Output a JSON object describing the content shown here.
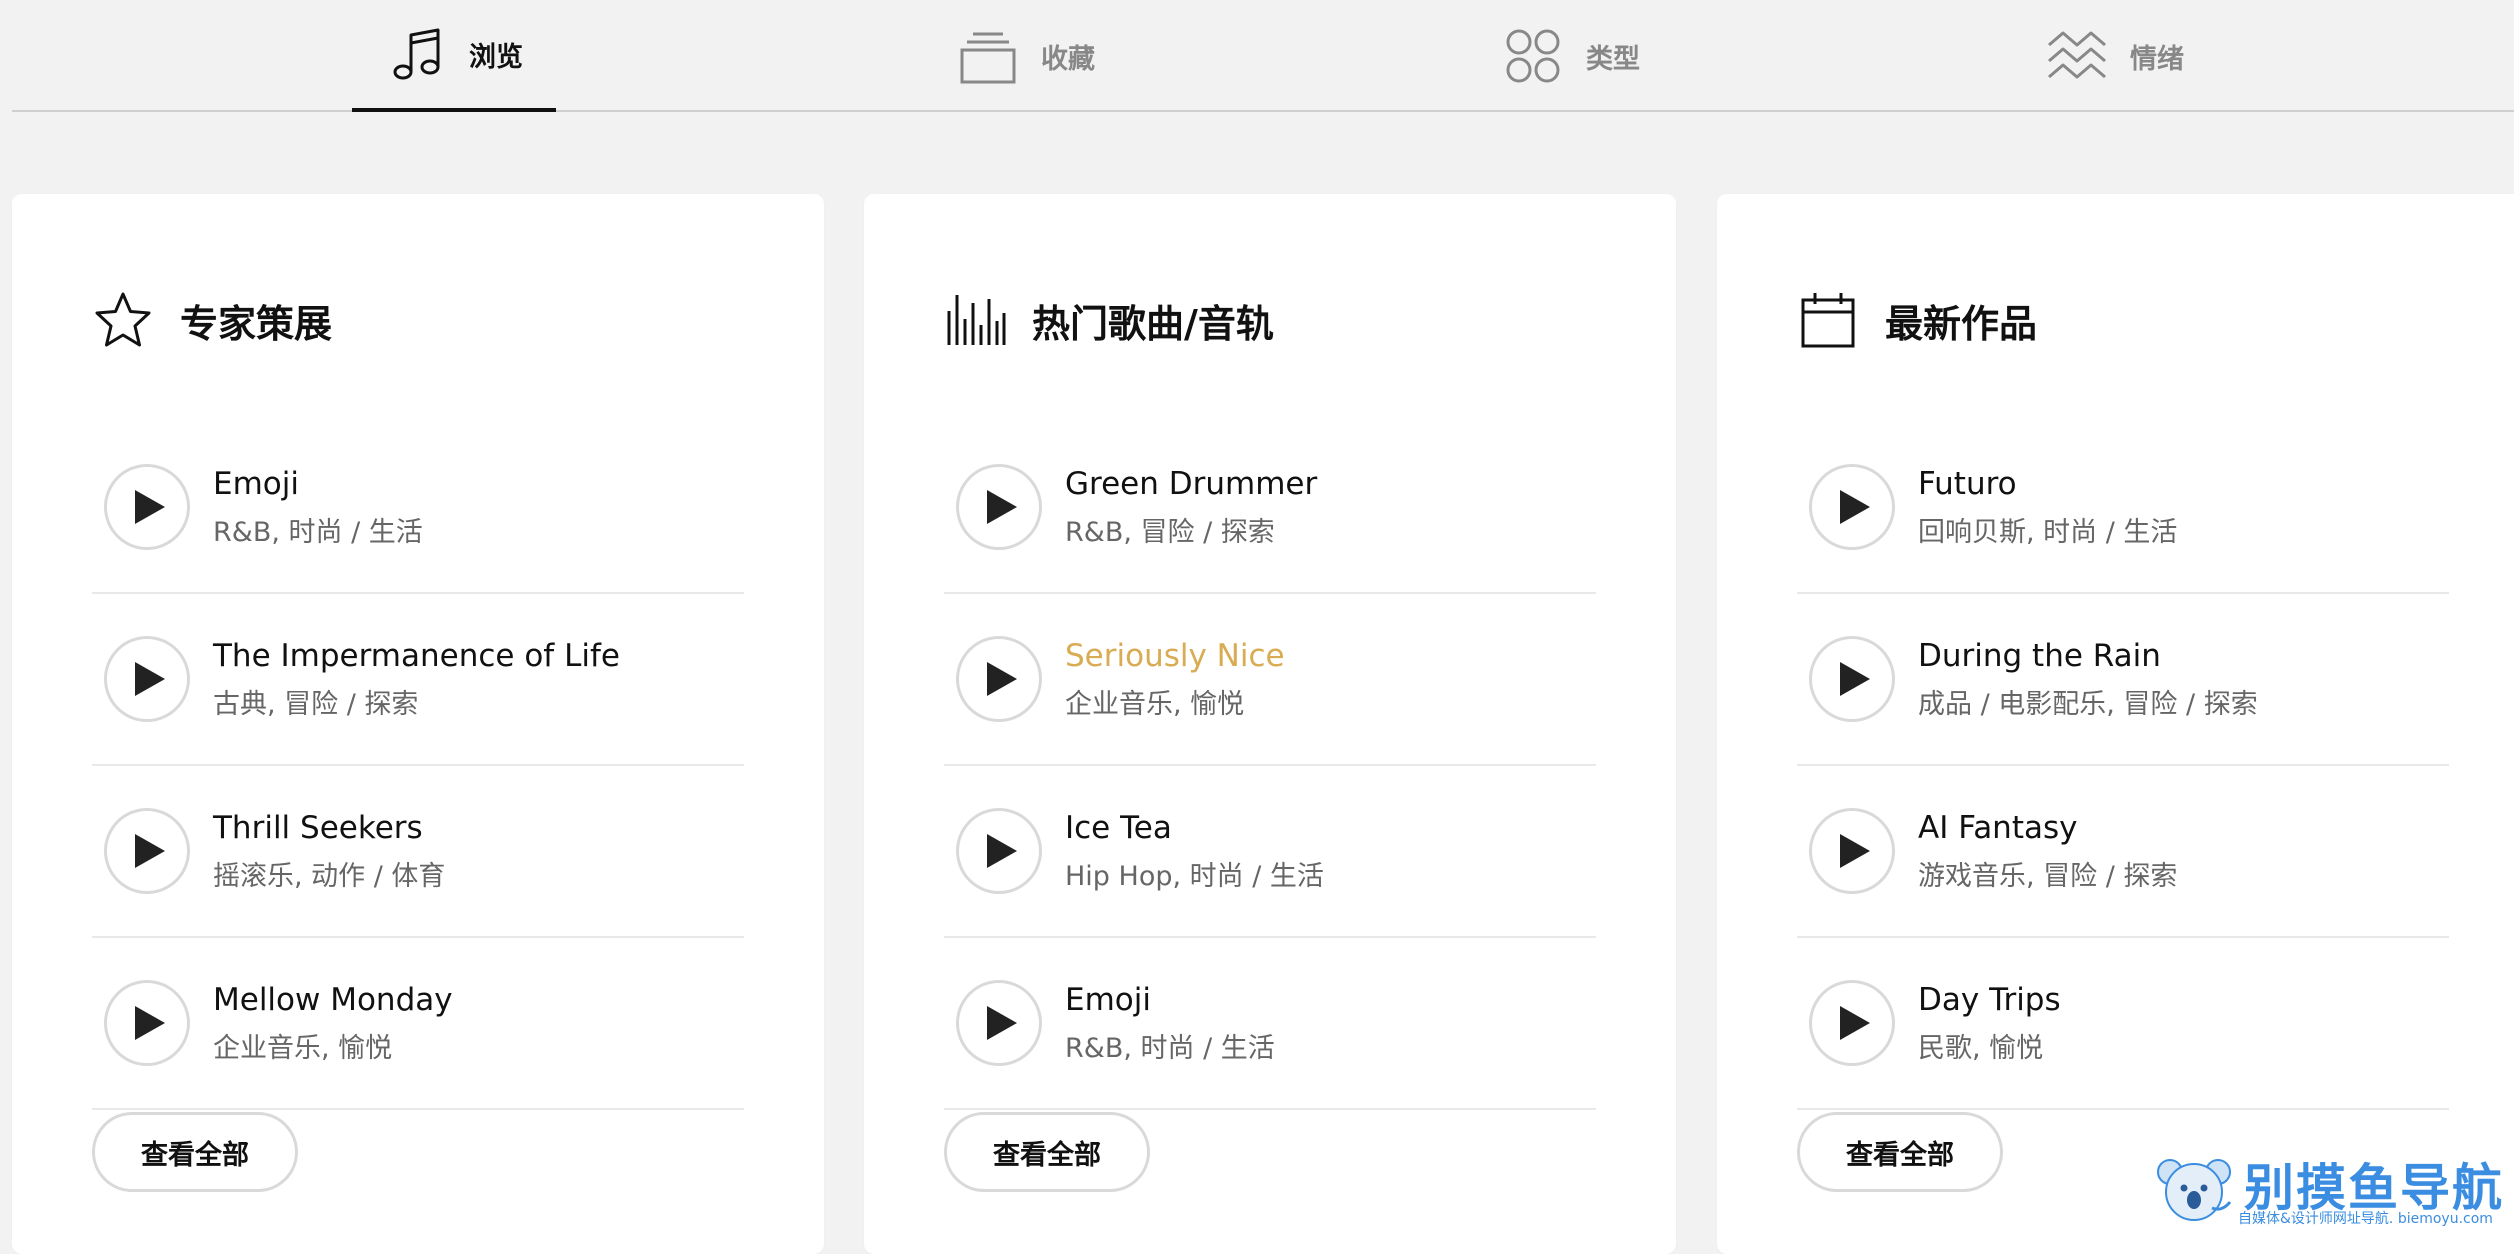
{
  "tabs": [
    {
      "label": "浏览",
      "icon": "music-note-icon",
      "active": true
    },
    {
      "label": "收藏",
      "icon": "collection-stack-icon",
      "active": false
    },
    {
      "label": "类型",
      "icon": "four-circles-grid-icon",
      "active": false
    },
    {
      "label": "情绪",
      "icon": "waves-icon",
      "active": false
    }
  ],
  "cards": [
    {
      "title": "专家策展",
      "icon": "star-icon",
      "tracks": [
        {
          "title": "Emoji",
          "tags": "R&B, 时尚 / 生活"
        },
        {
          "title": "The Impermanence of Life",
          "tags": "古典, 冒险 / 探索"
        },
        {
          "title": "Thrill Seekers",
          "tags": "摇滚乐, 动作 / 体育"
        },
        {
          "title": "Mellow Monday",
          "tags": "企业音乐, 愉悦"
        }
      ],
      "view_all": "查看全部"
    },
    {
      "title": "热门歌曲/音轨",
      "icon": "bars-chart-icon",
      "tracks": [
        {
          "title": "Green Drummer",
          "tags": "R&B, 冒险 / 探索"
        },
        {
          "title": "Seriously Nice",
          "tags": "企业音乐, 愉悦",
          "highlighted": true
        },
        {
          "title": "Ice Tea",
          "tags": "Hip Hop, 时尚 / 生活"
        },
        {
          "title": "Emoji",
          "tags": "R&B, 时尚 / 生活"
        }
      ],
      "view_all": "查看全部"
    },
    {
      "title": "最新作品",
      "icon": "calendar-icon",
      "tracks": [
        {
          "title": "Futuro",
          "tags": "回响贝斯, 时尚 / 生活"
        },
        {
          "title": "During the Rain",
          "tags": "成品 / 电影配乐, 冒险 / 探索"
        },
        {
          "title": "AI Fantasy",
          "tags": "游戏音乐, 冒险 / 探索"
        },
        {
          "title": "Day Trips",
          "tags": "民歌, 愉悦"
        }
      ],
      "view_all": "查看全部"
    }
  ],
  "watermark": {
    "title": "别摸鱼导航",
    "subtitle": "自媒体&设计师网址导航. biemoyu.com"
  },
  "colors": {
    "background": "#f2f2f2",
    "card": "#ffffff",
    "highlight": "#d9ab52",
    "watermark": "#3a8de0"
  }
}
